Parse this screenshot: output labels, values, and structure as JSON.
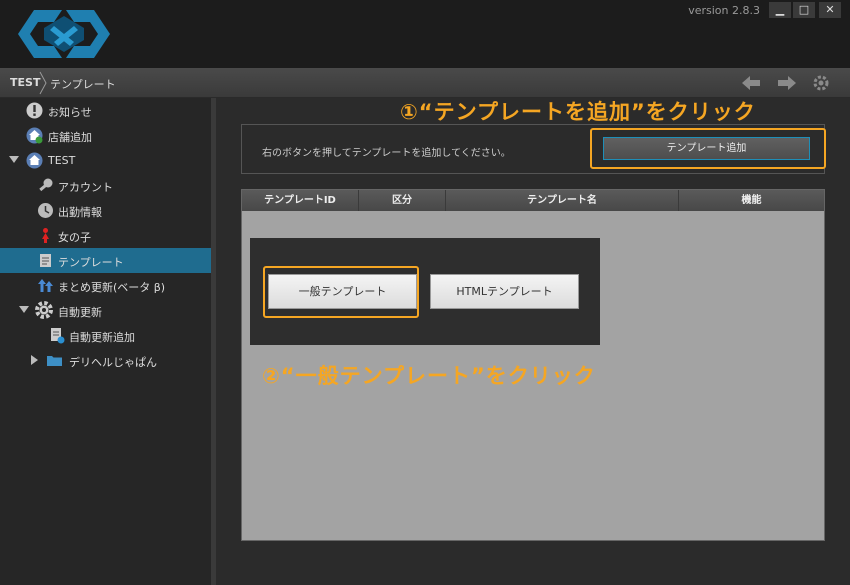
{
  "window": {
    "version": "version 2.8.3",
    "minimize": "▁",
    "maximize": "□",
    "close": "✕"
  },
  "breadcrumb": {
    "root": "TEST",
    "page": "テンプレート"
  },
  "nav": {
    "back_icon": "arrow-left-icon",
    "forward_icon": "arrow-right-icon",
    "settings_icon": "gear-icon"
  },
  "sidebar": {
    "items": [
      {
        "label": "お知らせ",
        "icon": "info-icon"
      },
      {
        "label": "店舗追加",
        "icon": "home-add-icon"
      },
      {
        "label": "TEST",
        "icon": "home-icon",
        "expanded": true
      },
      {
        "label": "アカウント",
        "icon": "wrench-icon"
      },
      {
        "label": "出勤情報",
        "icon": "clock-icon"
      },
      {
        "label": "女の子",
        "icon": "person-icon"
      },
      {
        "label": "テンプレート",
        "icon": "document-icon",
        "active": true
      },
      {
        "label": "まとめ更新(ベータ β)",
        "icon": "arrows-up-icon"
      },
      {
        "label": "自動更新",
        "icon": "gear-icon",
        "expanded": true
      },
      {
        "label": "自動更新追加",
        "icon": "document-add-icon"
      },
      {
        "label": "デリヘルじゃぱん",
        "icon": "folder-icon",
        "expanded": false
      }
    ]
  },
  "main": {
    "info_text": "右のボタンを押してテンプレートを追加してください。",
    "add_button": "テンプレート追加",
    "table_headers": [
      "テンプレートID",
      "区分",
      "テンプレート名",
      "機能"
    ],
    "popup": {
      "general_button": "一般テンプレート",
      "html_button": "HTMLテンプレート"
    }
  },
  "annotations": {
    "step1": "①“テンプレートを追加”をクリック",
    "step2": "②“一般テンプレート”をクリック",
    "color": "#f5a623"
  },
  "colors": {
    "accent": "#1f6c8f",
    "highlight": "#f5a623",
    "sidebar_bg": "#262626",
    "table_bg": "#a3a3a3"
  }
}
